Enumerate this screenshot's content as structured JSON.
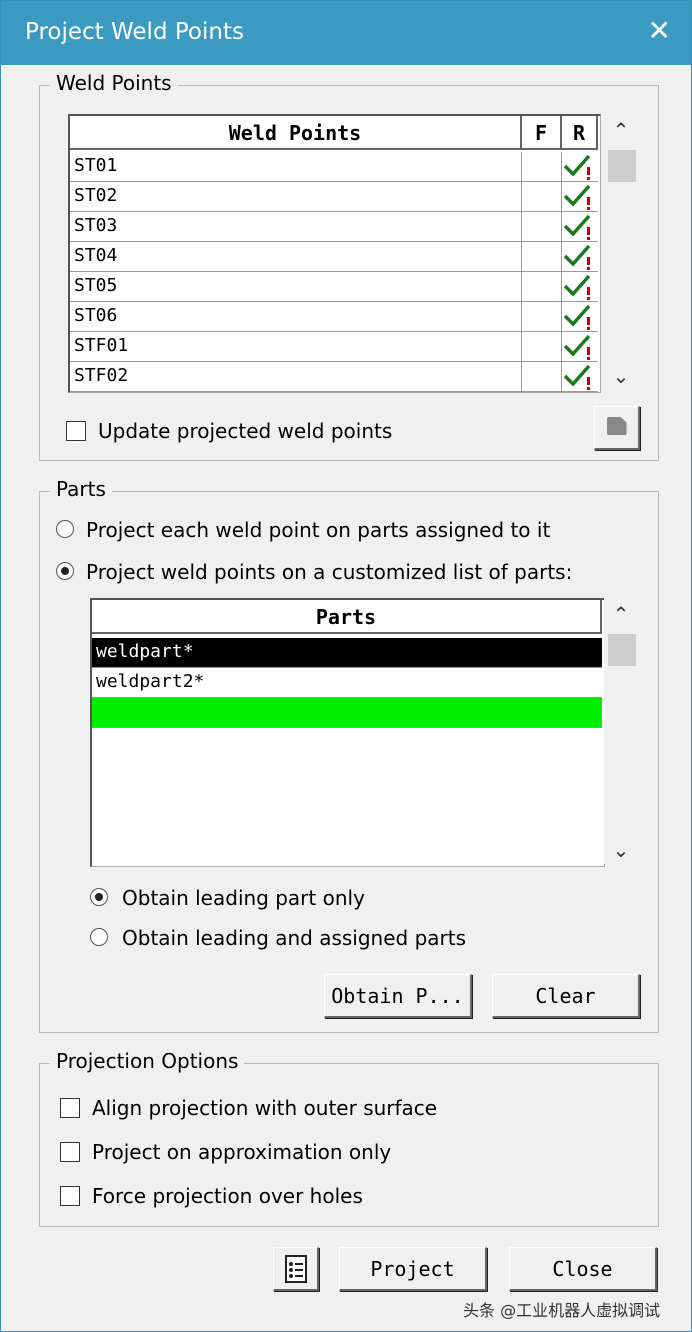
{
  "window": {
    "title": "Project Weld Points"
  },
  "weld_group": {
    "legend": "Weld Points",
    "columns": [
      "Weld Points",
      "F",
      "R"
    ],
    "rows": [
      {
        "name": "ST01"
      },
      {
        "name": "ST02"
      },
      {
        "name": "ST03"
      },
      {
        "name": "ST04"
      },
      {
        "name": "ST05"
      },
      {
        "name": "ST06"
      },
      {
        "name": "STF01"
      },
      {
        "name": "STF02"
      }
    ],
    "update_label": "Update projected weld points"
  },
  "parts_group": {
    "legend": "Parts",
    "option_each": "Project each weld point on parts assigned to it",
    "option_custom": "Project weld points on a customized list of parts:",
    "list_header": "Parts",
    "items": [
      "weldpart*",
      "weldpart2*"
    ],
    "obtain_leading": "Obtain leading part only",
    "obtain_leading_assigned": "Obtain leading and assigned parts",
    "obtain_button": "Obtain P...",
    "clear_button": "Clear"
  },
  "projection_group": {
    "legend": "Projection Options",
    "align": "Align projection with outer surface",
    "approx": "Project on approximation only",
    "force": "Force projection over holes"
  },
  "footer": {
    "project_button": "Project",
    "close_button": "Close"
  },
  "watermark": "头条 @工业机器人虚拟调试",
  "colors": {
    "titlebar": "#3b9ac2",
    "selected_row": "#000000",
    "new_row": "#00ee00",
    "check": "#1a7a1a",
    "warn": "#cc0000"
  }
}
